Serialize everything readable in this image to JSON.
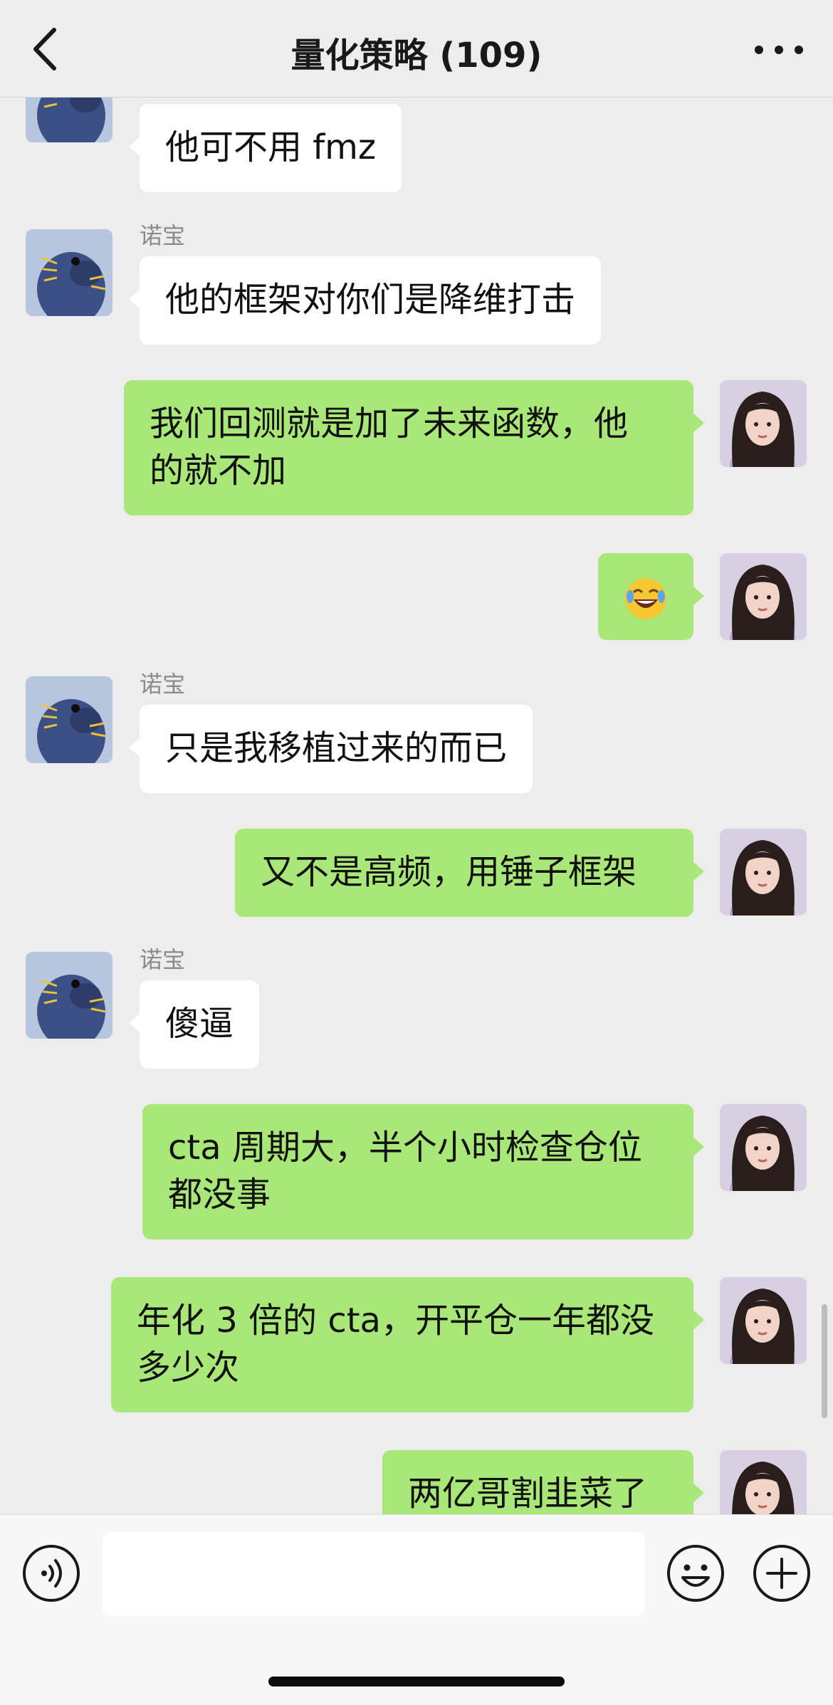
{
  "header": {
    "title": "量化策略 (109)"
  },
  "messages": [
    {
      "side": "left",
      "sender": "",
      "text": "他可不用 fmz"
    },
    {
      "side": "left",
      "sender": "诺宝",
      "text": "他的框架对你们是降维打击"
    },
    {
      "side": "right",
      "text": "我们回测就是加了未来函数，他\n的就不加"
    },
    {
      "side": "right",
      "emoji": "joy-emoji"
    },
    {
      "side": "left",
      "sender": "诺宝",
      "text": "只是我移植过来的而已"
    },
    {
      "side": "right",
      "text": "又不是高频，用锤子框架"
    },
    {
      "side": "left",
      "sender": "诺宝",
      "text": "傻逼"
    },
    {
      "side": "right",
      "text": "cta 周期大，半个小时检查仓位\n都没事"
    },
    {
      "side": "right",
      "text": "年化 3 倍的 cta，开平仓一年都没\n多少次"
    },
    {
      "side": "right",
      "text": "两亿哥割韭菜了"
    }
  ],
  "input": {
    "value": ""
  },
  "colors": {
    "background": "#ededed",
    "sent_bubble": "#a9e878",
    "received_bubble": "#ffffff"
  }
}
